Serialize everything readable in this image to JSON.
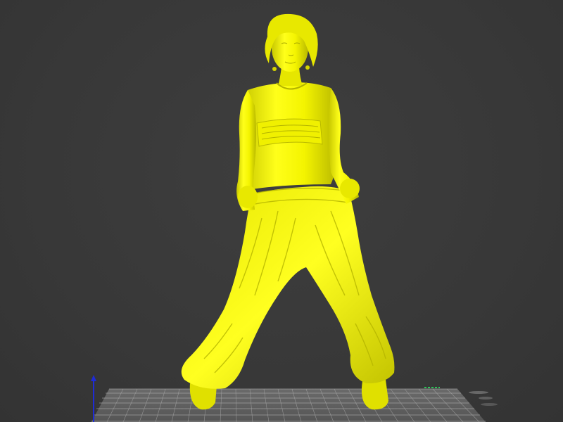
{
  "viewport": {
    "background_color": "#3a3a3a",
    "model_color": "#ffff00",
    "model_highlight_color": "#ffff66",
    "model_shadow_color": "#c8c800",
    "grid_color": "#9a9a9a",
    "build_plate_color": "#5a5a5a",
    "z_axis_color": "#1e2bd6",
    "axis_marker_color": "#2ec45a"
  },
  "model": {
    "icon": "figure-icon"
  }
}
